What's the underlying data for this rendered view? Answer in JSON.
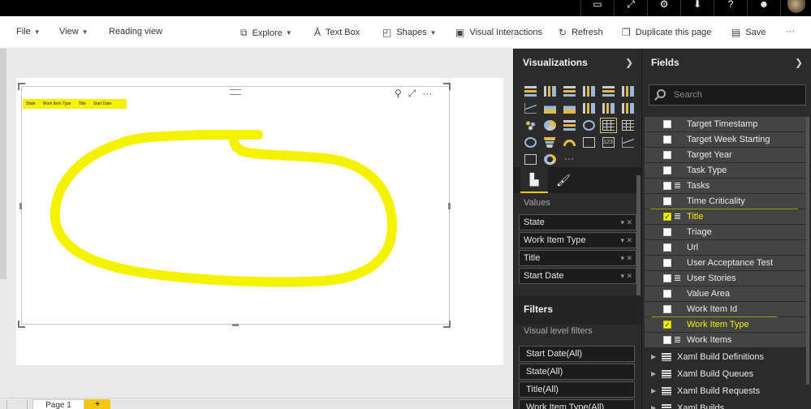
{
  "titlebar": {
    "icons": [
      "feedback-icon",
      "expand-icon",
      "settings-icon",
      "download-icon",
      "help-icon",
      "smiley-icon",
      "user-avatar"
    ]
  },
  "ribbon": {
    "file": "File",
    "view": "View",
    "reading_view": "Reading view",
    "explore": "Explore",
    "text_box": "Text Box",
    "shapes": "Shapes",
    "visual_interactions": "Visual Interactions",
    "refresh": "Refresh",
    "duplicate_page": "Duplicate this page",
    "save": "Save",
    "more": "···"
  },
  "visual": {
    "columns": [
      "State",
      "Work Item Type",
      "Title",
      "Start Date"
    ]
  },
  "pagebar": {
    "page_tab": "Page 1",
    "add_label": "+"
  },
  "visualizations": {
    "title": "Visualizations",
    "values_label": "Values",
    "wells": [
      "State",
      "Work Item Type",
      "Title",
      "Start Date"
    ],
    "filters_title": "Filters",
    "visual_level_filters": "Visual level filters",
    "filters": [
      "Start Date(All)",
      "State(All)",
      "Title(All)",
      "Work Item Type(All)"
    ]
  },
  "fields": {
    "title": "Fields",
    "search_placeholder": "Search",
    "items": [
      {
        "label": "Target Timestamp",
        "checked": false
      },
      {
        "label": "Target Week Starting",
        "checked": false
      },
      {
        "label": "Target Year",
        "checked": false
      },
      {
        "label": "Task Type",
        "checked": false
      },
      {
        "label": "Tasks",
        "checked": false
      },
      {
        "label": "Time Criticality",
        "checked": false
      },
      {
        "label": "Title",
        "checked": true
      },
      {
        "label": "Triage",
        "checked": false
      },
      {
        "label": "Url",
        "checked": false
      },
      {
        "label": "User Acceptance Test",
        "checked": false
      },
      {
        "label": "User Stories",
        "checked": false
      },
      {
        "label": "Value Area",
        "checked": false
      },
      {
        "label": "Work Item Id",
        "checked": false
      },
      {
        "label": "Work Item Type",
        "checked": true
      },
      {
        "label": "Work Items",
        "checked": false
      }
    ],
    "tables": [
      "Xaml Build Definitions",
      "Xaml Build Queues",
      "Xaml Build Requests",
      "Xaml Builds"
    ]
  },
  "colors": {
    "accent": "#f2c811",
    "highlighter": "#f5f200",
    "pane_bg": "#2b2b2b"
  }
}
